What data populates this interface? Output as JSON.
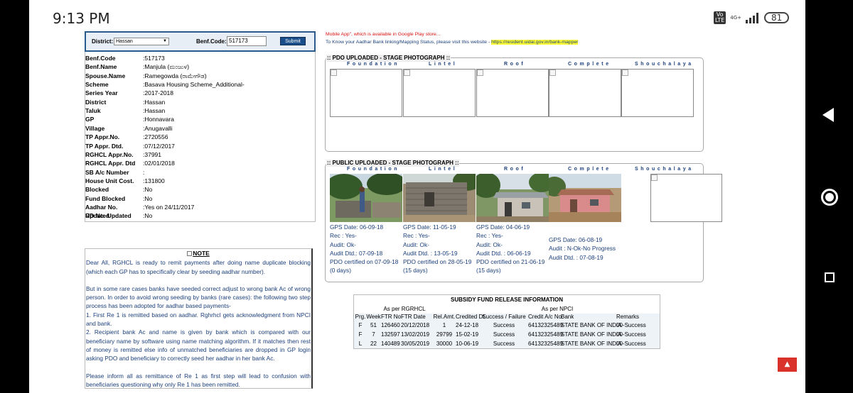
{
  "status_bar": {
    "time": "9:13 PM",
    "volte": "Vo\nLTE",
    "net_type": "4G+",
    "battery": "81"
  },
  "search": {
    "district_label": "District:",
    "district_value": "Hassan",
    "benf_code_label": "Benf.Code:",
    "benf_code_value": "517173",
    "submit_label": "Submit"
  },
  "beneficiary": [
    {
      "key": "Benf.Code",
      "value": ":517173"
    },
    {
      "key": "Benf.Name",
      "value": ":Manjula    (ಮಂಜುಳ)"
    },
    {
      "key": "Spouse.Name",
      "value": ":Ramegowda   (ರಾಮೇಗೌಡ)"
    },
    {
      "key": "Scheme",
      "value": ":Basava Housing Scheme_Additional-"
    },
    {
      "key": "Series Year",
      "value": ":2017-2018"
    },
    {
      "key": "District",
      "value": ":Hassan"
    },
    {
      "key": "Taluk",
      "value": ":Hassan"
    },
    {
      "key": "GP",
      "value": ":Honnavara"
    },
    {
      "key": "Village",
      "value": ":Anugavalli"
    },
    {
      "key": "TP Appr.No.",
      "value": ":2720556"
    },
    {
      "key": "TP Appr. Dtd.",
      "value": ":07/12/2017"
    },
    {
      "key": "RGHCL Appr.No.",
      "value": ":37991"
    },
    {
      "key": "RGHCL Appr. Dtd",
      "value": ":02/01/2018"
    },
    {
      "key": "SB A/c Number",
      "value": ":"
    },
    {
      "key": "House Unit Cost.",
      "value": ":131800"
    },
    {
      "key": "Blocked",
      "value": ":No"
    },
    {
      "key": "Fund Blocked",
      "value": ":No"
    },
    {
      "key": "Aadhar No. Updated",
      "value": ":Yes on 24/11/2017"
    },
    {
      "key": "RD No. Updated",
      "value": ":No"
    }
  ],
  "note": {
    "title": "NOTE",
    "p1": "Dear All, RGHCL is ready to remit payments after doing name duplicate blocking (which each GP has to specifically clear by seeding aadhar number).",
    "p2": "But in some rare cases banks have seeded correct adjust to wrong bank Ac of wrong person. In order to avoid wrong seeding by banks (rare cases): the following two step process has been adopted for aadhar based payments-",
    "p3": "1. First Re 1 is remitted based on aadhar. Rghrhcl gets acknowledgment from NPCI and bank.",
    "p4": "2. Recipient bank Ac and name is given by bank which is compared with our beneficiary name by software using name matching algorithm. If it matches then rest of money is remitted else info of unmatched beneficiaries are dropped in GP login asking PDO and beneficiary to correctly seed her aadhar in her bank Ac.",
    "p5": "Please inform all as remittance of Re 1 as first step will lead to confusion with beneficiaries questioning why only Re 1 has been remitted."
  },
  "aadhar_msg": {
    "line1": "Mobile App\", which is available in Google Play store...",
    "line2": "To Know your Aadhar Bank linking/Mapping Status, please visit this website - ",
    "link": "https://resident.uidai.gov.in/bank-mapper"
  },
  "pdo_panel": {
    "title": ":: PDO UPLOADED - STAGE PHOTOGRAPH ::"
  },
  "public_panel": {
    "title": ":: PUBLIC UPLOADED - STAGE PHOTOGRAPH ::"
  },
  "stages": [
    "Foundation",
    "Lintel",
    "Roof",
    "Complete",
    "Shouchalaya"
  ],
  "public_captions": [
    [
      "GPS Date: 06-09-18",
      "Rec : Yes-",
      "Audit: Ok-",
      "Audit Dtd.: 07-09-18",
      "PDO certified on 07-09-18",
      "(0 days)"
    ],
    [
      "GPS Date: 11-05-19",
      "Rec : Yes-",
      "Audit: Ok-",
      "Audit Dtd. : 13-05-19",
      "PDO certified on 28-05-19",
      "(15 days)"
    ],
    [
      "GPS Date: 04-06-19",
      "Rec : Yes-",
      "Audit: Ok-",
      "Audit Dtd. : 06-06-19",
      "PDO certified on 21-06-19",
      "(15 days)"
    ],
    [
      "GPS Date: 06-08-19",
      "Audit : N-Ok-No Progress",
      "Audit Dtd. : 07-08-19"
    ]
  ],
  "subsidy": {
    "title": "SUBSIDY FUND RELEASE INFORMATION",
    "group1": "As per RGRHCL",
    "group2": "As per NPCI",
    "headers": [
      "Prg.",
      "Week",
      "FTR No.",
      "FTR Date",
      "Rel.Amt.",
      "Credited Dt.",
      "Success / Failure",
      "Credit A/c No.",
      "Bank",
      "Remarks"
    ],
    "rows": [
      [
        "F",
        "51",
        "126460",
        "20/12/2018",
        "1",
        "24-12-18",
        "Success",
        "64132325489",
        "STATE BANK OF INDIA",
        "00-Success"
      ],
      [
        "F",
        "7",
        "132597",
        "13/02/2019",
        "29799",
        "15-02-19",
        "Success",
        "64132325489",
        "STATE BANK OF INDIA",
        "00-Success"
      ],
      [
        "L",
        "22",
        "140489",
        "30/05/2019",
        "30000",
        "10-06-19",
        "Success",
        "64132325489",
        "STATE BANK OF INDIA",
        "00-Success"
      ]
    ]
  },
  "colors": {
    "accent": "#1a4f8b",
    "text_blue": "#1b3f7a",
    "scroll_top": "#d8322b",
    "highlight": "#ffff33"
  }
}
